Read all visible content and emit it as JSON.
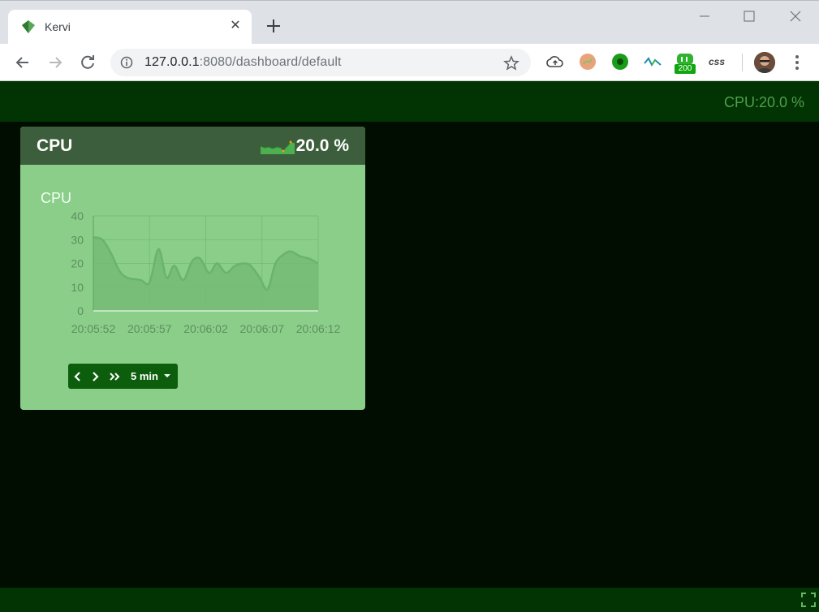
{
  "browser": {
    "tab_title": "Kervi",
    "url_host": "127.0.0.1",
    "url_rest": ":8080/dashboard/default",
    "extension_badge": "200",
    "extension_css_label": "css"
  },
  "header": {
    "status_label": "CPU:20.0 %"
  },
  "card": {
    "title": "CPU",
    "value": "20.0 %",
    "chart_title": "CPU",
    "range_label": "5 min"
  },
  "chart_data": {
    "type": "area",
    "title": "CPU",
    "xlabel": "",
    "ylabel": "",
    "ylim": [
      0,
      40
    ],
    "y_ticks": [
      "0",
      "10",
      "20",
      "30",
      "40"
    ],
    "x_ticks": [
      "20:05:52",
      "20:05:57",
      "20:06:02",
      "20:06:07",
      "20:06:12"
    ],
    "x_tick_seconds": [
      0,
      5,
      10,
      15,
      20
    ],
    "grid": true,
    "series": [
      {
        "x": [
          0,
          0.8,
          1.6,
          2.3,
          3.0,
          4.2,
          5.0,
          5.8,
          6.5,
          7.2,
          8.0,
          8.8,
          9.5,
          10.3,
          11.0,
          11.8,
          12.6,
          13.4,
          14.0,
          14.8,
          15.5,
          16.2,
          17.0,
          17.6,
          18.4,
          19.2,
          20.0
        ],
        "y": [
          31,
          30,
          24,
          17,
          14,
          13,
          12,
          26,
          14,
          19,
          13,
          21,
          22,
          16,
          20,
          16,
          19,
          20,
          19,
          14,
          9,
          20,
          24,
          25,
          23,
          22,
          20
        ]
      }
    ],
    "colors": {
      "line": "#6ab46a",
      "fill": "#74ba74",
      "grid": "#77bd77",
      "axis_text": "#5d8e5d"
    }
  },
  "colors": {
    "page_bg": "#010d01",
    "header_bg": "#023302",
    "card_bg": "#8ace8a",
    "card_head_bg": "#3c5e3c",
    "range_btn_bg": "#0c5e0c",
    "status_text": "#4f9e4f"
  }
}
